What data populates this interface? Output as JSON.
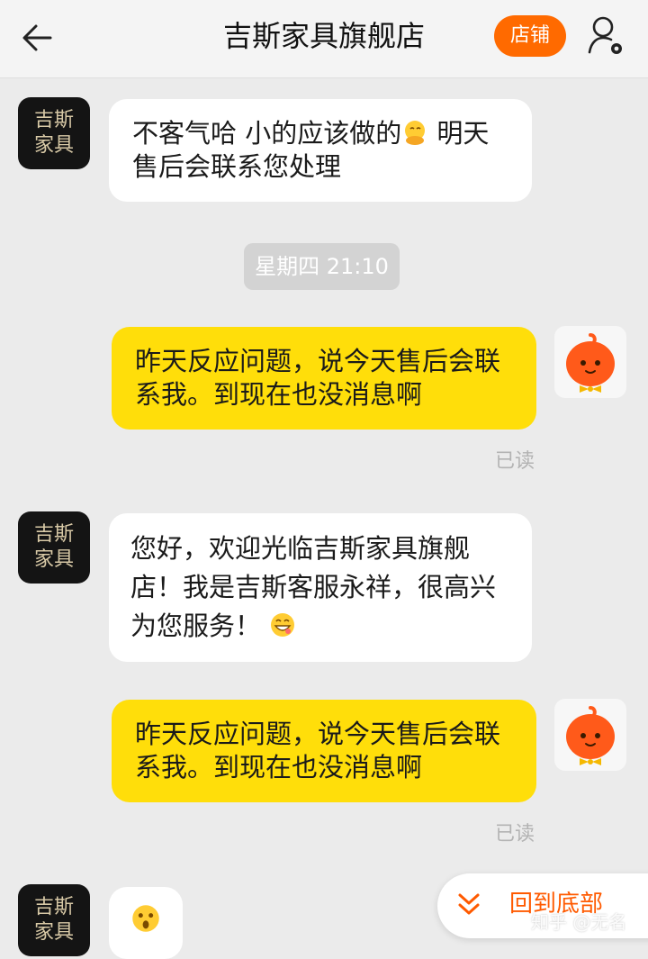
{
  "header": {
    "title": "吉斯家具旗舰店",
    "shop_button_label": "店铺",
    "back_icon": "arrow-left-icon",
    "user_icon": "user-settings-icon",
    "accent_color": "#ff6a00"
  },
  "shop_avatar": {
    "line1": "吉斯",
    "line2": "家具"
  },
  "messages": [
    {
      "side": "left",
      "text_part1": "不客气哈 小的应该做的",
      "emoji": "hands-clasped-face-emoji",
      "text_part2": " 明天售后会联系您处理"
    },
    {
      "side": "right",
      "text": "昨天反应问题，说今天售后会联系我。到现在也没消息啊",
      "status": "已读"
    },
    {
      "side": "left",
      "text": "您好，欢迎光临吉斯家具旗舰店！我是吉斯客服永祥，很高兴为您服务！",
      "emoji": "grin-face-emoji"
    },
    {
      "side": "right",
      "text": "昨天反应问题，说今天售后会联系我。到现在也没消息啊",
      "status": "已读"
    },
    {
      "side": "left",
      "emoji": "shocked-face-emoji"
    }
  ],
  "timestamp": "星期四 21:10",
  "scroll_to_bottom_label": "回到底部",
  "watermark": "知乎 @无名",
  "colors": {
    "bubble_mine": "#ffde0a",
    "bubble_theirs": "#ffffff",
    "background": "#ebebeb"
  }
}
